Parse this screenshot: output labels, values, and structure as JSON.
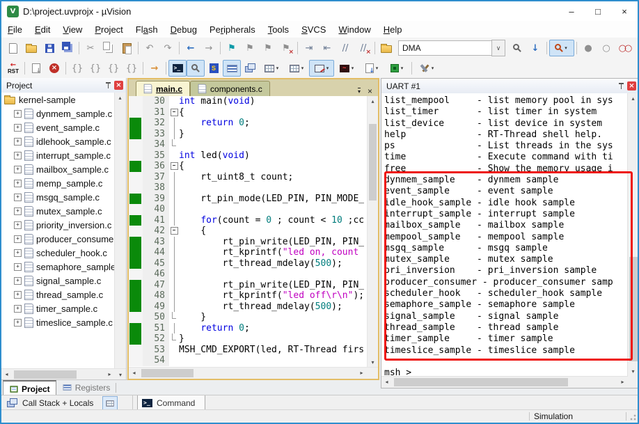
{
  "window": {
    "title": "D:\\project.uvprojx - µVision",
    "caption_buttons": {
      "minimize": "–",
      "maximize": "□",
      "close": "×"
    }
  },
  "menu": [
    {
      "label": "File",
      "u": 0
    },
    {
      "label": "Edit",
      "u": 0
    },
    {
      "label": "View",
      "u": 0
    },
    {
      "label": "Project",
      "u": 0
    },
    {
      "label": "Flash",
      "u": 2
    },
    {
      "label": "Debug",
      "u": 0
    },
    {
      "label": "Peripherals",
      "u": 2
    },
    {
      "label": "Tools",
      "u": 0
    },
    {
      "label": "SVCS",
      "u": 0
    },
    {
      "label": "Window",
      "u": 0
    },
    {
      "label": "Help",
      "u": 0
    }
  ],
  "toolbar1a": [
    {
      "n": "new-file",
      "k": "page"
    },
    {
      "n": "open-file",
      "k": "folder"
    },
    {
      "n": "save",
      "k": "floppy"
    },
    {
      "n": "save-all",
      "k": "floppy2"
    },
    {
      "k": "sep"
    },
    {
      "n": "cut",
      "k": "g",
      "g": "✂",
      "c": "c-gray"
    },
    {
      "n": "copy",
      "k": "copy"
    },
    {
      "n": "paste",
      "k": "paste"
    },
    {
      "k": "sep"
    },
    {
      "n": "undo",
      "k": "g",
      "g": "↶",
      "c": "c-gray"
    },
    {
      "n": "redo",
      "k": "g",
      "g": "↷",
      "c": "c-gray"
    },
    {
      "k": "sep"
    },
    {
      "n": "navigate-back",
      "k": "g",
      "g": "←",
      "c": "c-blue"
    },
    {
      "n": "navigate-forward",
      "k": "g",
      "g": "→",
      "c": "c-gray"
    },
    {
      "k": "sep"
    },
    {
      "n": "bookmark-toggle",
      "k": "g",
      "g": "⚑",
      "c": "c-teal"
    },
    {
      "n": "bookmark-prev",
      "k": "g",
      "g": "⚑",
      "c": "c-gray"
    },
    {
      "n": "bookmark-next",
      "k": "g",
      "g": "⚑",
      "c": "c-gray"
    },
    {
      "n": "bookmark-clear-all",
      "k": "g",
      "g": "⚑",
      "c": "c-gray",
      "x": true
    },
    {
      "k": "sep"
    },
    {
      "n": "indent",
      "k": "g",
      "g": "⇥",
      "c": "c-slate"
    },
    {
      "n": "outdent",
      "k": "g",
      "g": "⇤",
      "c": "c-slate"
    },
    {
      "n": "comment-selection",
      "k": "g",
      "g": "//",
      "c": "c-slate"
    },
    {
      "n": "uncomment-selection",
      "k": "g",
      "g": "//",
      "c": "c-slate",
      "x": true
    },
    {
      "k": "sep"
    },
    {
      "n": "configure-flash-tools",
      "k": "folder"
    }
  ],
  "combo": {
    "value": "DMA",
    "drop_glyph": "∨"
  },
  "toolbar1b": [
    {
      "n": "find-in-files",
      "k": "mag"
    },
    {
      "n": "incremental-find",
      "k": "g",
      "g": "↓",
      "c": "c-blue"
    },
    {
      "k": "sep"
    },
    {
      "n": "find-dropdown",
      "k": "mag",
      "red": true,
      "dd": true,
      "hl": true
    },
    {
      "k": "sep"
    },
    {
      "n": "insert-breakpoint",
      "k": "g",
      "g": "●",
      "c": "c-gray"
    },
    {
      "n": "enable-disable-breakpoint",
      "k": "g",
      "g": "○",
      "c": "c-gray"
    },
    {
      "n": "disable-all-breakpoints",
      "k": "g",
      "g": "○○",
      "c": "c-red",
      "ls": true
    },
    {
      "n": "kill-all-breakpoints",
      "k": "g",
      "g": "○",
      "c": "c-red",
      "x": true
    },
    {
      "k": "sep"
    },
    {
      "n": "manage-window-layout",
      "k": "winlist",
      "hl": true
    }
  ],
  "toolbar2": [
    {
      "n": "reset-cpu",
      "k": "rst"
    },
    {
      "k": "sep"
    },
    {
      "n": "show-next-statement",
      "k": "flow"
    },
    {
      "n": "stop-debug",
      "k": "stopx"
    },
    {
      "k": "sep"
    },
    {
      "n": "step-into",
      "k": "g",
      "g": "{}",
      "c": "c-gray"
    },
    {
      "n": "step-over",
      "k": "g",
      "g": "{}",
      "c": "c-gray"
    },
    {
      "n": "step-out",
      "k": "g",
      "g": "{}",
      "c": "c-gray"
    },
    {
      "n": "run-to-line",
      "k": "g",
      "g": "{}",
      "c": "c-gray"
    },
    {
      "k": "sep"
    },
    {
      "n": "run",
      "k": "g",
      "g": "→",
      "c": "c-orange"
    },
    {
      "k": "sep"
    },
    {
      "n": "command-window",
      "k": "console",
      "hl": true
    },
    {
      "n": "disassembly-window",
      "k": "mag",
      "hl": true
    },
    {
      "n": "symbol-window",
      "k": "sdoc"
    },
    {
      "n": "registers-window",
      "k": "lines",
      "hl": true
    },
    {
      "n": "call-stack-window",
      "k": "winstack"
    },
    {
      "n": "watch-window",
      "k": "grid",
      "dd": true
    },
    {
      "n": "memory-window",
      "k": "grid",
      "dd": true
    },
    {
      "n": "serial-windows",
      "k": "serial",
      "dd": true,
      "hl": true
    },
    {
      "n": "analysis-windows",
      "k": "wave",
      "dd": true
    },
    {
      "n": "trace-windows",
      "k": "pagedown",
      "dd": true
    },
    {
      "n": "system-viewer",
      "k": "chip",
      "dd": true
    },
    {
      "k": "sep"
    },
    {
      "n": "debug-settings",
      "k": "tools",
      "dd": true
    }
  ],
  "project": {
    "title": "Project",
    "root": "kernel-sample",
    "files": [
      "dynmem_sample.c",
      "event_sample.c",
      "idlehook_sample.c",
      "interrupt_sample.c",
      "mailbox_sample.c",
      "memp_sample.c",
      "msgq_sample.c",
      "mutex_sample.c",
      "priority_inversion.c",
      "producer_consumer",
      "scheduler_hook.c",
      "semaphore_sample.",
      "signal_sample.c",
      "thread_sample.c",
      "timer_sample.c",
      "timeslice_sample.c"
    ],
    "tabs": [
      {
        "label": "Project"
      },
      {
        "label": "Registers"
      }
    ]
  },
  "editor": {
    "tabs": [
      {
        "label": "main.c"
      },
      {
        "label": "components.c"
      }
    ],
    "lines": [
      {
        "n": 30,
        "cov": false,
        "fold": "",
        "seg": [
          [
            "kw",
            "int"
          ],
          [
            "pl",
            " main("
          ],
          [
            "kw",
            "void"
          ],
          [
            "pl",
            ")"
          ]
        ]
      },
      {
        "n": 31,
        "cov": false,
        "fold": "box",
        "seg": [
          [
            "pl",
            "{"
          ]
        ]
      },
      {
        "n": 32,
        "cov": true,
        "fold": "v",
        "seg": [
          [
            "pl",
            "    "
          ],
          [
            "kw",
            "return"
          ],
          [
            "pl",
            " "
          ],
          [
            "num",
            "0"
          ],
          [
            "pl",
            ";"
          ]
        ]
      },
      {
        "n": 33,
        "cov": true,
        "fold": "v",
        "seg": [
          [
            "pl",
            "}"
          ]
        ]
      },
      {
        "n": 34,
        "cov": false,
        "fold": "end",
        "seg": []
      },
      {
        "n": 35,
        "cov": false,
        "fold": "",
        "seg": [
          [
            "kw",
            "int"
          ],
          [
            "pl",
            " led("
          ],
          [
            "kw",
            "void"
          ],
          [
            "pl",
            ")"
          ]
        ]
      },
      {
        "n": 36,
        "cov": true,
        "fold": "box",
        "seg": [
          [
            "pl",
            "{"
          ]
        ]
      },
      {
        "n": 37,
        "cov": false,
        "fold": "v",
        "seg": [
          [
            "pl",
            "    rt_uint8_t count;"
          ]
        ]
      },
      {
        "n": 38,
        "cov": false,
        "fold": "v",
        "seg": []
      },
      {
        "n": 39,
        "cov": true,
        "fold": "v",
        "seg": [
          [
            "pl",
            "    rt_pin_mode(LED_PIN, PIN_MODE_"
          ]
        ]
      },
      {
        "n": 40,
        "cov": false,
        "fold": "v",
        "seg": []
      },
      {
        "n": 41,
        "cov": true,
        "fold": "v",
        "seg": [
          [
            "pl",
            "    "
          ],
          [
            "kw",
            "for"
          ],
          [
            "pl",
            "(count = "
          ],
          [
            "num",
            "0"
          ],
          [
            "pl",
            " ; count < "
          ],
          [
            "num",
            "10"
          ],
          [
            "pl",
            " ;cc"
          ]
        ]
      },
      {
        "n": 42,
        "cov": false,
        "fold": "box",
        "seg": [
          [
            "pl",
            "    {"
          ]
        ]
      },
      {
        "n": 43,
        "cov": true,
        "fold": "v",
        "seg": [
          [
            "pl",
            "        rt_pin_write(LED_PIN, PIN_"
          ]
        ]
      },
      {
        "n": 44,
        "cov": true,
        "fold": "v",
        "seg": [
          [
            "pl",
            "        rt_kprintf("
          ],
          [
            "str",
            "\"led on, count"
          ]
        ]
      },
      {
        "n": 45,
        "cov": true,
        "fold": "v",
        "seg": [
          [
            "pl",
            "        rt_thread_mdelay("
          ],
          [
            "num",
            "500"
          ],
          [
            "pl",
            ");"
          ]
        ]
      },
      {
        "n": 46,
        "cov": false,
        "fold": "v",
        "seg": []
      },
      {
        "n": 47,
        "cov": true,
        "fold": "v",
        "seg": [
          [
            "pl",
            "        rt_pin_write(LED_PIN, PIN_"
          ]
        ]
      },
      {
        "n": 48,
        "cov": true,
        "fold": "v",
        "seg": [
          [
            "pl",
            "        rt_kprintf("
          ],
          [
            "str",
            "\"led off\\r\\n\""
          ],
          [
            "pl",
            ");"
          ]
        ]
      },
      {
        "n": 49,
        "cov": true,
        "fold": "v",
        "seg": [
          [
            "pl",
            "        rt_thread_mdelay("
          ],
          [
            "num",
            "500"
          ],
          [
            "pl",
            ");"
          ]
        ]
      },
      {
        "n": 50,
        "cov": false,
        "fold": "end",
        "seg": [
          [
            "pl",
            "    }"
          ]
        ]
      },
      {
        "n": 51,
        "cov": true,
        "fold": "v",
        "seg": [
          [
            "pl",
            "    "
          ],
          [
            "kw",
            "return"
          ],
          [
            "pl",
            " "
          ],
          [
            "num",
            "0"
          ],
          [
            "pl",
            ";"
          ]
        ]
      },
      {
        "n": 52,
        "cov": true,
        "fold": "end",
        "seg": [
          [
            "pl",
            "}"
          ]
        ]
      },
      {
        "n": 53,
        "cov": false,
        "fold": "",
        "seg": [
          [
            "pl",
            "MSH_CMD_EXPORT(led, RT-Thread firs"
          ]
        ]
      },
      {
        "n": 54,
        "cov": false,
        "fold": "",
        "seg": []
      }
    ]
  },
  "uart": {
    "title": "UART #1",
    "lines": [
      "list_mempool     - list memory pool in sys",
      "list_timer       - list timer in system",
      "list_device      - list device in system",
      "help             - RT-Thread shell help.",
      "ps               - List threads in the sys",
      "time             - Execute command with ti",
      "free             - Show the memory usage i",
      "dynmem_sample    - dynmem sample",
      "event_sample     - event sample",
      "idle_hook_sample - idle hook sample",
      "interrupt_sample - interrupt sample",
      "mailbox_sample   - mailbox sample",
      "mempool_sample   - mempool sample",
      "msgq_sample      - msgq sample",
      "mutex_sample     - mutex sample",
      "pri_inversion    - pri_inversion sample",
      "producer_consumer - producer_consumer samp",
      "scheduler_hook   - scheduler_hook sample",
      "semaphore_sample - semaphore sample",
      "signal_sample    - signal sample",
      "thread_sample    - thread sample",
      "timer_sample     - timer sample",
      "timeslice_sample - timeslice sample",
      "",
      "msh >"
    ],
    "highlight_color": "#ee1410"
  },
  "bottom": {
    "call_stack_label": "Call Stack + Locals",
    "command_label": "Command"
  },
  "status": {
    "mode": "Simulation"
  }
}
